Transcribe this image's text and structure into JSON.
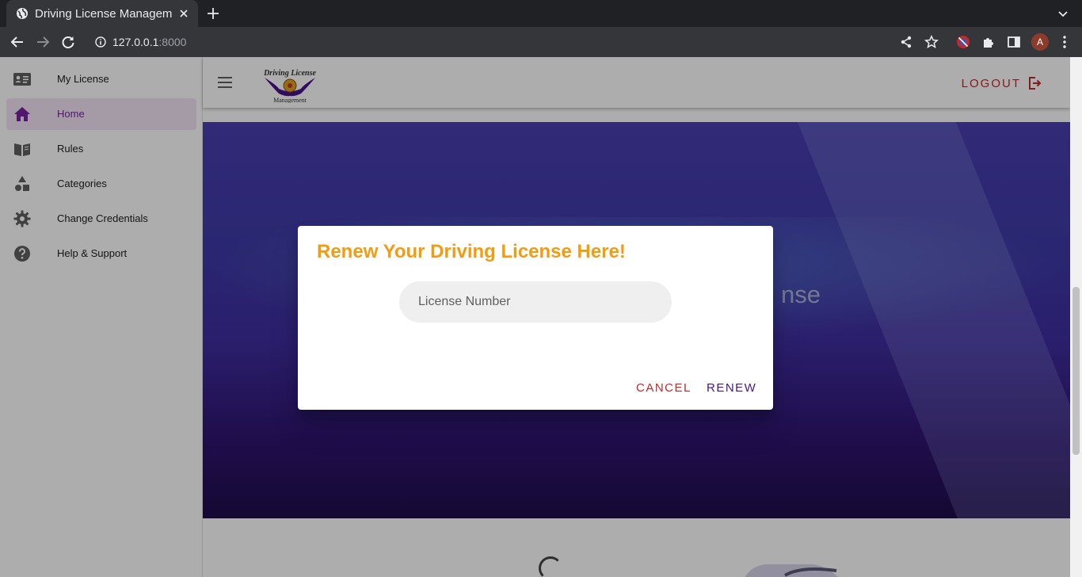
{
  "browser": {
    "tab_title": "Driving License Management",
    "url_host": "127.0.0.1",
    "url_port": ":8000",
    "profile_initial": "A"
  },
  "sidebar": {
    "items": [
      {
        "label": "My License",
        "icon": "id-card-icon",
        "active": false
      },
      {
        "label": "Home",
        "icon": "home-icon",
        "active": true
      },
      {
        "label": "Rules",
        "icon": "book-icon",
        "active": false
      },
      {
        "label": "Categories",
        "icon": "shapes-icon",
        "active": false
      },
      {
        "label": "Change Credentials",
        "icon": "gear-icon",
        "active": false
      },
      {
        "label": "Help & Support",
        "icon": "help-icon",
        "active": false
      }
    ]
  },
  "appbar": {
    "logo_text_top": "Driving License",
    "logo_text_bottom": "Management",
    "logout_label": "LOGOUT"
  },
  "hero": {
    "partial_text": "nse"
  },
  "dialog": {
    "title": "Renew Your Driving License Here!",
    "input_placeholder": "License Number",
    "cancel_label": "CANCEL",
    "renew_label": "RENEW"
  },
  "colors": {
    "accent_purple": "#7b1fa2",
    "title_orange": "#f39c12",
    "danger_red": "#c62828",
    "renew_purple": "#4a148c"
  }
}
